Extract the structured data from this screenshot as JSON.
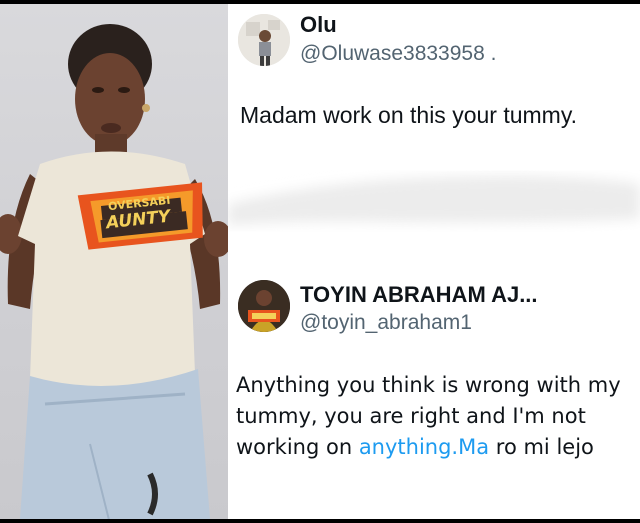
{
  "tweet1": {
    "author_name": "Olu",
    "handle": "@Oluwase3833958 .",
    "text": "Madam work on this your tummy."
  },
  "tweet2": {
    "author_name": "TOYIN ABRAHAM AJ...",
    "handle": "@toyin_abraham1",
    "text_part1": "Anything you think is wrong with my tummy, you are right and I'm not working on ",
    "link_text": "anything.Ma",
    "text_part2": " ro mi lejo"
  },
  "photo": {
    "shirt_top_text": "OVERSABI",
    "shirt_bottom_text": "AUNTY"
  },
  "colors": {
    "link": "#1d9bf0",
    "handle": "#536471",
    "text": "#0f1419"
  }
}
